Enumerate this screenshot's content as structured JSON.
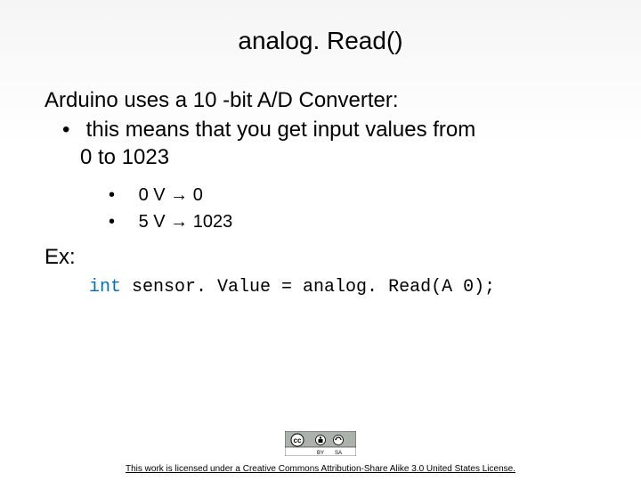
{
  "title": "analog. Read()",
  "intro": "Arduino uses a 10 -bit A/D Converter:",
  "bullet1_part1": "this means that you get input values from",
  "bullet1_part2": "0 to 1023",
  "sub_bullets": [
    {
      "label": "0 V ",
      "arrow": "→",
      "value": " 0"
    },
    {
      "label": "5 V ",
      "arrow": "→",
      "value": " 1023"
    }
  ],
  "ex_label": "Ex:",
  "code": {
    "type_kw": "int ",
    "rest": "sensor. Value = analog. Read(A 0);"
  },
  "license": "This work is licensed under a Creative Commons Attribution-Share Alike 3.0 United States License.",
  "cc_badge": {
    "by": "BY",
    "sa": "SA"
  }
}
